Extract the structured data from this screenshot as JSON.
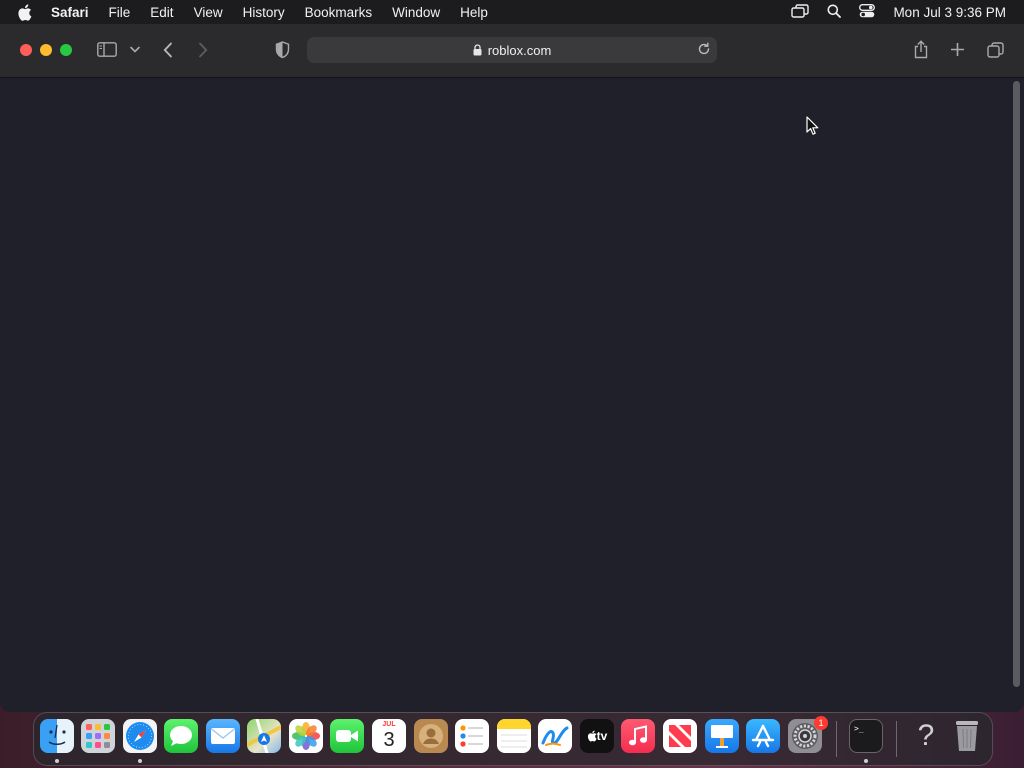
{
  "menubar": {
    "app_name": "Safari",
    "items": [
      "File",
      "Edit",
      "View",
      "History",
      "Bookmarks",
      "Window",
      "Help"
    ],
    "clock": "Mon Jul 3  9:36 PM"
  },
  "browser": {
    "url": "roblox.com"
  },
  "dock": {
    "calendar_month": "JUL",
    "calendar_day": "3",
    "appletv_label": "tv",
    "settings_badge": "1",
    "terminal_prompt": ">_",
    "help_glyph": "?"
  },
  "colors": {
    "close": "#ff5f57",
    "minimize": "#febc2e",
    "maximize": "#28c840",
    "content_bg": "#1f2029",
    "toolbar_bg": "#2b2b2d"
  }
}
